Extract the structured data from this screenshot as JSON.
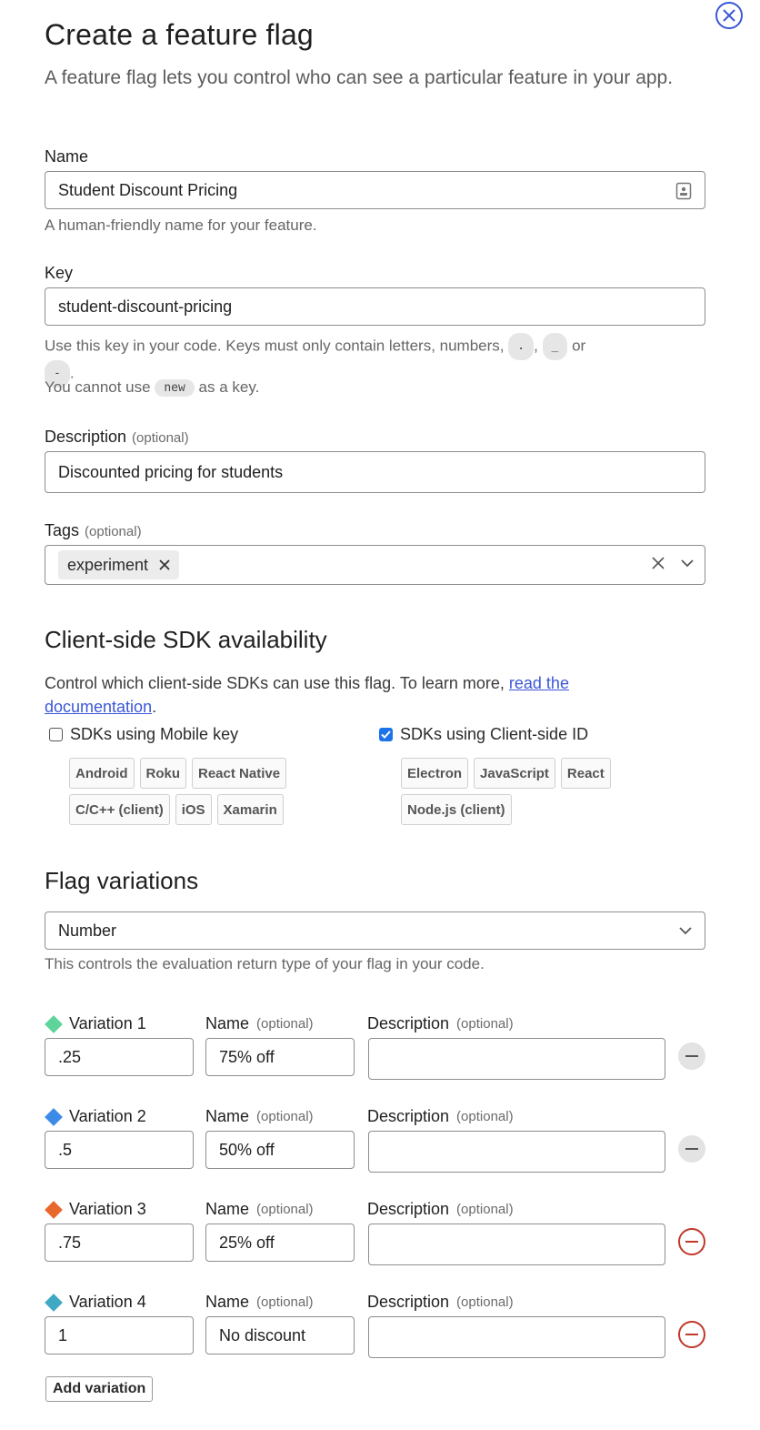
{
  "header": {
    "title": "Create a feature flag",
    "intro": "A feature flag lets you control who can see a particular feature in your app."
  },
  "name_field": {
    "label": "Name",
    "value": "Student Discount Pricing",
    "hint": "A human-friendly name for your feature."
  },
  "key_field": {
    "label": "Key",
    "value": "student-discount-pricing",
    "hint_start": "Use this key in your code. Keys must only contain letters, numbers,",
    "chip_dot": ".",
    "chip_underscore": "_",
    "hint_or": "or",
    "chip_dash": "-",
    "hint_period": ".",
    "hint2_start": "You cannot use",
    "chip_new": "new",
    "hint2_end": "as a key."
  },
  "description_field": {
    "label": "Description",
    "optional": "(optional)",
    "value": "Discounted pricing for students"
  },
  "tags_field": {
    "label": "Tags",
    "optional": "(optional)",
    "tags": [
      "experiment"
    ]
  },
  "sdk_section": {
    "title": "Client-side SDK availability",
    "desc": "Control which client-side SDKs can use this flag. To learn more, ",
    "link": "read the documentation",
    "desc_end": ".",
    "mobile": {
      "label": "SDKs using Mobile key",
      "checked": false,
      "chips": [
        "Android",
        "Roku",
        "React Native",
        "C/C++ (client)",
        "iOS",
        "Xamarin"
      ]
    },
    "client": {
      "label": "SDKs using Client-side ID",
      "checked": true,
      "chips": [
        "Electron",
        "JavaScript",
        "React",
        "Node.js (client)"
      ]
    }
  },
  "variations_section": {
    "title": "Flag variations",
    "type_value": "Number",
    "hint": "This controls the evaluation return type of your flag in your code.",
    "name_label": "Name",
    "desc_label": "Description",
    "optional": "(optional)",
    "variations": [
      {
        "label": "Variation 1",
        "value": ".25",
        "name": "75% off",
        "description": "",
        "color": "#5fd49a",
        "removable": false
      },
      {
        "label": "Variation 2",
        "value": ".5",
        "name": "50% off",
        "description": "",
        "color": "#3d8be8",
        "removable": false
      },
      {
        "label": "Variation 3",
        "value": ".75",
        "name": "25% off",
        "description": "",
        "color": "#e8672c",
        "removable": true
      },
      {
        "label": "Variation 4",
        "value": "1",
        "name": "No discount",
        "description": "",
        "color": "#3fa9c4",
        "removable": true
      }
    ],
    "add_label": "Add variation"
  },
  "icons": {
    "close": "close-icon",
    "lock": "contact-card-icon",
    "tag_remove": "close-icon",
    "clear": "close-icon",
    "chevron": "chevron-down-icon",
    "remove_variation": "minus-circle-icon"
  }
}
